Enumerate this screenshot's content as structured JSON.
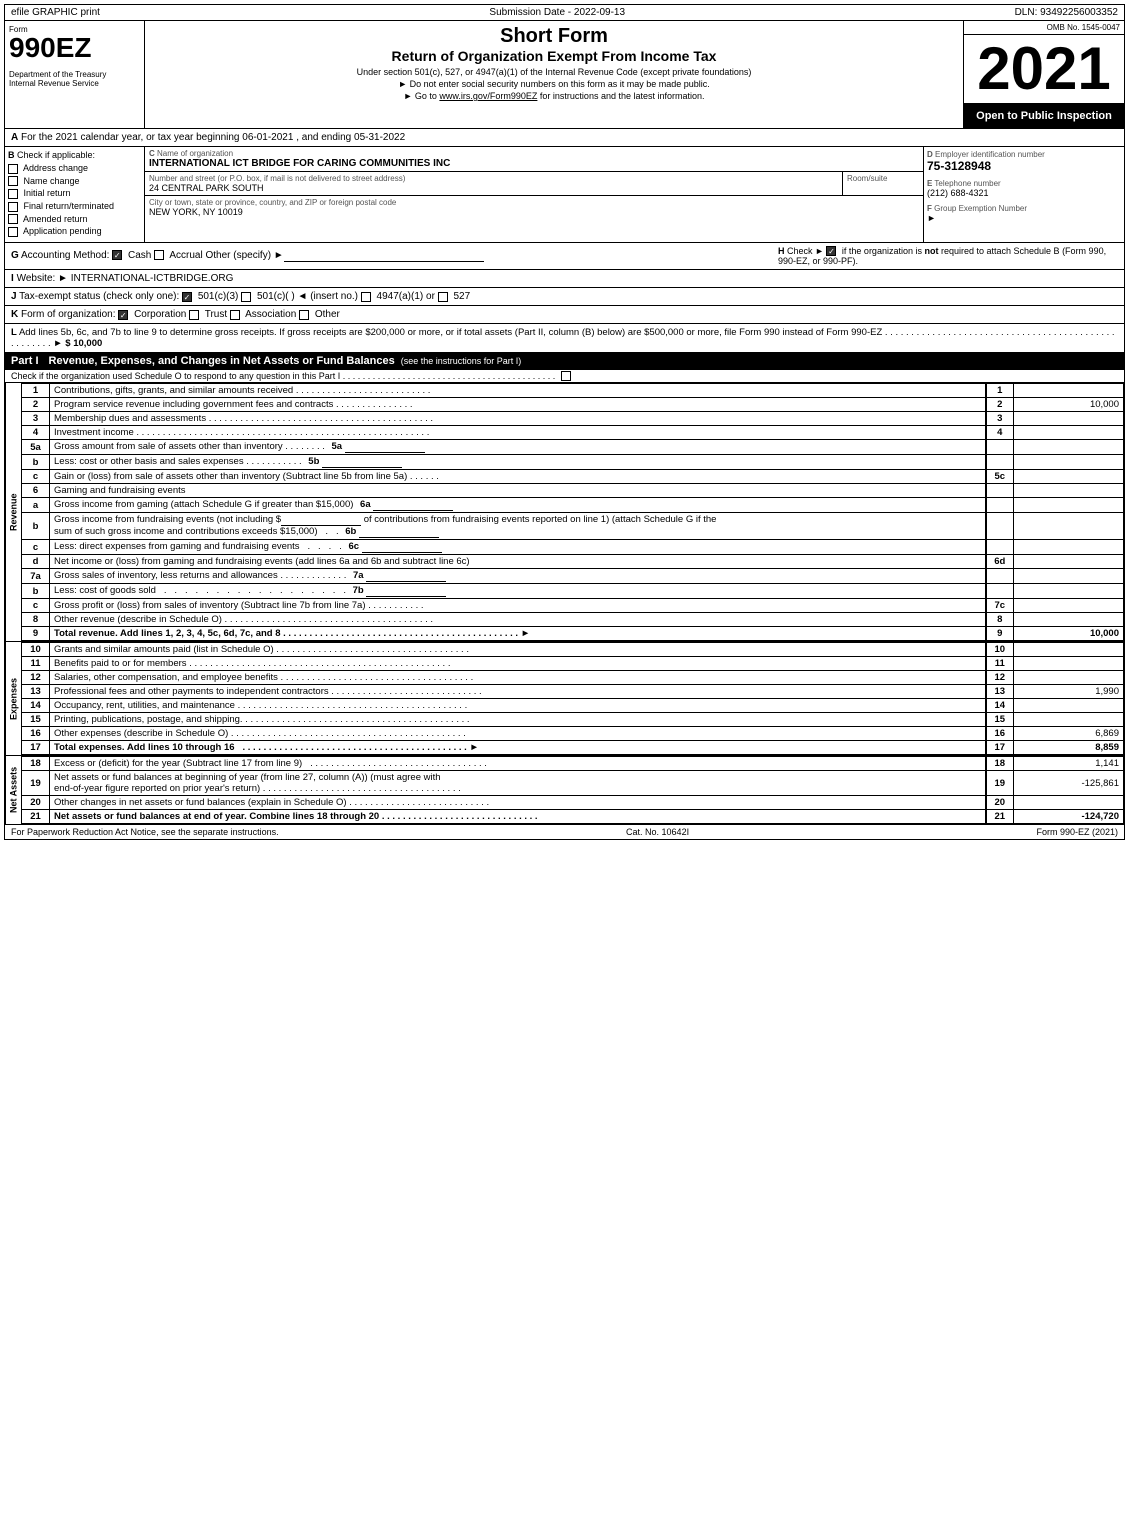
{
  "topBar": {
    "left": "efile GRAPHIC print",
    "middle": "Submission Date - 2022-09-13",
    "right": "DLN: 93492256003352"
  },
  "formHeader": {
    "formNumber": "990EZ",
    "title1": "Short Form",
    "title2": "Return of Organization Exempt From Income Tax",
    "subtitle": "Under section 501(c), 527, or 4947(a)(1) of the Internal Revenue Code (except private foundations)",
    "notice1": "► Do not enter social security numbers on this form as it may be made public.",
    "notice2": "► Go to www.irs.gov/Form990EZ for instructions and the latest information.",
    "year": "2021",
    "openInspection": "Open to Public Inspection",
    "ombNo": "OMB No. 1545-0047",
    "deptLabel": "Department of the Treasury",
    "irsLabel": "Internal Revenue Service"
  },
  "sectionA": {
    "label": "A",
    "text": "For the 2021 calendar year, or tax year beginning 06-01-2021 , and ending 05-31-2022"
  },
  "sectionB": {
    "label": "B  Check if applicable:",
    "items": [
      {
        "id": "address-change",
        "label": "Address change",
        "checked": false
      },
      {
        "id": "name-change",
        "label": "Name change",
        "checked": false
      },
      {
        "id": "initial-return",
        "label": "Initial return",
        "checked": false
      },
      {
        "id": "final-return",
        "label": "Final return/terminated",
        "checked": false
      },
      {
        "id": "amended-return",
        "label": "Amended return",
        "checked": false
      },
      {
        "id": "application-pending",
        "label": "Application pending",
        "checked": false
      }
    ]
  },
  "sectionC": {
    "label": "C",
    "nameLabel": "Name of organization",
    "orgName": "INTERNATIONAL ICT BRIDGE FOR CARING COMMUNITIES INC",
    "streetLabel": "Number and street (or P.O. box, if mail is not delivered to street address)",
    "street": "24 CENTRAL PARK SOUTH",
    "roomLabel": "Room/suite",
    "room": "",
    "cityLabel": "City or town, state or province, country, and ZIP or foreign postal code",
    "city": "NEW YORK, NY  10019"
  },
  "sectionD": {
    "label": "D",
    "einLabel": "Employer identification number",
    "ein": "75-3128948",
    "phoneLabel": "E Telephone number",
    "phone": "(212) 688-4321",
    "groupLabel": "F Group Exemption Number",
    "groupArrow": "►"
  },
  "sectionG": {
    "label": "G",
    "accountingLabel": "Accounting Method:",
    "cashLabel": "Cash",
    "cashChecked": true,
    "accrualLabel": "Accrual",
    "accrualChecked": false,
    "otherLabel": "Other (specify) ►"
  },
  "sectionH": {
    "label": "H",
    "checkLabel": "Check ►",
    "text": "if the organization is not required to attach Schedule B (Form 990, 990-EZ, or 990-PF).",
    "checked": true
  },
  "sectionI": {
    "label": "I",
    "websiteLabel": "Website: ►",
    "website": "INTERNATIONAL-ICTBRIDGE.ORG"
  },
  "sectionJ": {
    "label": "J",
    "taxLabel": "Tax-exempt status (check only one):",
    "options": "☑ 501(c)(3)  ○ 501(c)(   ) ◄ (insert no.)  ○ 4947(a)(1) or  ○ 527"
  },
  "sectionK": {
    "label": "K",
    "text": "Form of organization:",
    "corpChecked": true,
    "corpLabel": "Corporation",
    "trustLabel": "Trust",
    "assocLabel": "Association",
    "otherLabel": "Other"
  },
  "sectionL": {
    "label": "L",
    "text": "Add lines 5b, 6c, and 7b to line 9 to determine gross receipts. If gross receipts are $200,000 or more, or if total assets (Part II, column (B) below) are $500,000 or more, file Form 990 instead of Form 990-EZ",
    "dots": ". . . . . . . . . . . . . . . . . . . . . . . . . . . . . . . . . . . . . . . . . . . . . . . . . . . . ►",
    "amount": "$ 10,000"
  },
  "partI": {
    "label": "Part I",
    "title": "Revenue, Expenses, and Changes in Net Assets or Fund Balances",
    "seeInstructions": "(see the instructions for Part I)",
    "checkLine": "Check if the organization used Schedule O to respond to any question in this Part I",
    "lines": [
      {
        "num": "1",
        "desc": "Contributions, gifts, grants, and similar amounts received",
        "dots": ". . . . . . . . . . . . . . . . . . . . . . . . . .",
        "lineNum": "1",
        "value": ""
      },
      {
        "num": "2",
        "desc": "Program service revenue including government fees and contracts",
        "dots": ". . . . . . . . . . . . . . .",
        "lineNum": "2",
        "value": "10,000"
      },
      {
        "num": "3",
        "desc": "Membership dues and assessments",
        "dots": ". . . . . . . . . . . . . . . . . . . . . . . . . . . . . . . . . . . . . . . . . . .",
        "lineNum": "3",
        "value": ""
      },
      {
        "num": "4",
        "desc": "Investment income",
        "dots": ". . . . . . . . . . . . . . . . . . . . . . . . . . . . . . . . . . . . . . . . . . . . . . . . . . . . . . . . . . .",
        "lineNum": "4",
        "value": ""
      },
      {
        "num": "5a",
        "desc": "Gross amount from sale of assets other than inventory",
        "dots": ". . . . . . . .",
        "subRef": "5a",
        "subVal": ""
      },
      {
        "num": "b",
        "desc": "Less: cost or other basis and sales expenses",
        "dots": ". . . . . . . . . . .",
        "subRef": "5b",
        "subVal": ""
      },
      {
        "num": "c",
        "desc": "Gain or (loss) from sale of assets other than inventory (Subtract line 5b from line 5a)",
        "dots": ". . . . . .",
        "lineNum": "5c",
        "value": ""
      },
      {
        "num": "6",
        "desc": "Gaming and fundraising events",
        "lineNum": "",
        "value": ""
      },
      {
        "num": "a",
        "desc": "Gross income from gaming (attach Schedule G if greater than $15,000)",
        "subRef": "6a",
        "subVal": ""
      },
      {
        "num": "b",
        "desc": "Gross income from fundraising events (not including $______________of contributions from fundraising events reported on line 1) (attach Schedule G if the sum of such gross income and contributions exceeds $15,000)",
        "dots": "  .  .",
        "subRef": "6b",
        "subVal": ""
      },
      {
        "num": "c",
        "desc": "Less: direct expenses from gaming and fundraising events",
        "dots": "  .  .  .  .",
        "subRef": "6c",
        "subVal": ""
      },
      {
        "num": "d",
        "desc": "Net income or (loss) from gaming and fundraising events (add lines 6a and 6b and subtract line 6c)",
        "lineNum": "6d",
        "value": ""
      },
      {
        "num": "7a",
        "desc": "Gross sales of inventory, less returns and allowances",
        "dots": ". . . . . . . . . . . . .",
        "subRef": "7a",
        "subVal": ""
      },
      {
        "num": "b",
        "desc": "Less: cost of goods sold",
        "dots": "  .  .  .  .  .  .  .  .  .  .  .  .  .  .  .  .  .  .",
        "subRef": "7b",
        "subVal": ""
      },
      {
        "num": "c",
        "desc": "Gross profit or (loss) from sales of inventory (Subtract line 7b from line 7a)",
        "dots": ". . . . . . . . . . .",
        "lineNum": "7c",
        "value": ""
      },
      {
        "num": "8",
        "desc": "Other revenue (describe in Schedule O)",
        "dots": ". . . . . . . . . . . . . . . . . . . . . . . . . . . . . . . . . . . . . . . . .",
        "lineNum": "8",
        "value": ""
      },
      {
        "num": "9",
        "desc": "Total revenue. Add lines 1, 2, 3, 4, 5c, 6d, 7c, and 8",
        "dots": ". . . . . . . . . . . . . . . . . . . . . . . . . . . . . . . . . . . . . . . . . . . . . ►",
        "lineNum": "9",
        "value": "10,000",
        "bold": true
      }
    ],
    "expenseLines": [
      {
        "num": "10",
        "desc": "Grants and similar amounts paid (list in Schedule O)",
        "dots": ". . . . . . . . . . . . . . . . . . . . . . . . . . . . . . . . . . . . .",
        "lineNum": "10",
        "value": ""
      },
      {
        "num": "11",
        "desc": "Benefits paid to or for members",
        "dots": ". . . . . . . . . . . . . . . . . . . . . . . . . . . . . . . . . . . . . . . . . . . . . . . . . .",
        "lineNum": "11",
        "value": ""
      },
      {
        "num": "12",
        "desc": "Salaries, other compensation, and employee benefits",
        "dots": ". . . . . . . . . . . . . . . . . . . . . . . . . . . . . . . . . . . . .",
        "lineNum": "12",
        "value": ""
      },
      {
        "num": "13",
        "desc": "Professional fees and other payments to independent contractors",
        "dots": ". . . . . . . . . . . . . . . . . . . . . . . . . . . . .",
        "lineNum": "13",
        "value": "1,990"
      },
      {
        "num": "14",
        "desc": "Occupancy, rent, utilities, and maintenance",
        "dots": ". . . . . . . . . . . . . . . . . . . . . . . . . . . . . . . . . . . . . . . . . . . .",
        "lineNum": "14",
        "value": ""
      },
      {
        "num": "15",
        "desc": "Printing, publications, postage, and shipping.",
        "dots": ". . . . . . . . . . . . . . . . . . . . . . . . . . . . . . . . . . . . . . . . . . . .",
        "lineNum": "15",
        "value": ""
      },
      {
        "num": "16",
        "desc": "Other expenses (describe in Schedule O)",
        "dots": ". . . . . . . . . . . . . . . . . . . . . . . . . . . . . . . . . . . . . . . . . . . .",
        "lineNum": "16",
        "value": "6,869"
      },
      {
        "num": "17",
        "desc": "Total expenses. Add lines 10 through 16",
        "dots": ". . . . . . . . . . . . . . . . . . . . . . . . . . . . . . . . . . . . . . . . . . . ►",
        "lineNum": "17",
        "value": "8,859",
        "bold": true
      }
    ],
    "netAssetLines": [
      {
        "num": "18",
        "desc": "Excess or (deficit) for the year (Subtract line 17 from line 9)",
        "dots": ". . . . . . . . . . . . . . . . . . . . . . . . . . . . . . . . . . . .",
        "lineNum": "18",
        "value": "1,141"
      },
      {
        "num": "19",
        "desc": "Net assets or fund balances at beginning of year (from line 27, column (A)) (must agree with end-of-year figure reported on prior year's return)",
        "dots": ". . . . . . . . . . . . . . . . . . . . . . . . . . . . . . . . . . . . . .",
        "lineNum": "19",
        "value": "-125,861"
      },
      {
        "num": "20",
        "desc": "Other changes in net assets or fund balances (explain in Schedule O)",
        "dots": ". . . . . . . . . . . . . . . . . . . . . . . . . . . . . . . . .",
        "lineNum": "20",
        "value": ""
      },
      {
        "num": "21",
        "desc": "Net assets or fund balances at end of year. Combine lines 18 through 20",
        "dots": ". . . . . . . . . . . . . . . . . . . . . . . . . . . . . . . . . . . .",
        "lineNum": "21",
        "value": "-124,720",
        "bold": true
      }
    ]
  },
  "footer": {
    "left": "For Paperwork Reduction Act Notice, see the separate instructions.",
    "middle": "Cat. No. 10642I",
    "right": "Form 990-EZ (2021)"
  }
}
